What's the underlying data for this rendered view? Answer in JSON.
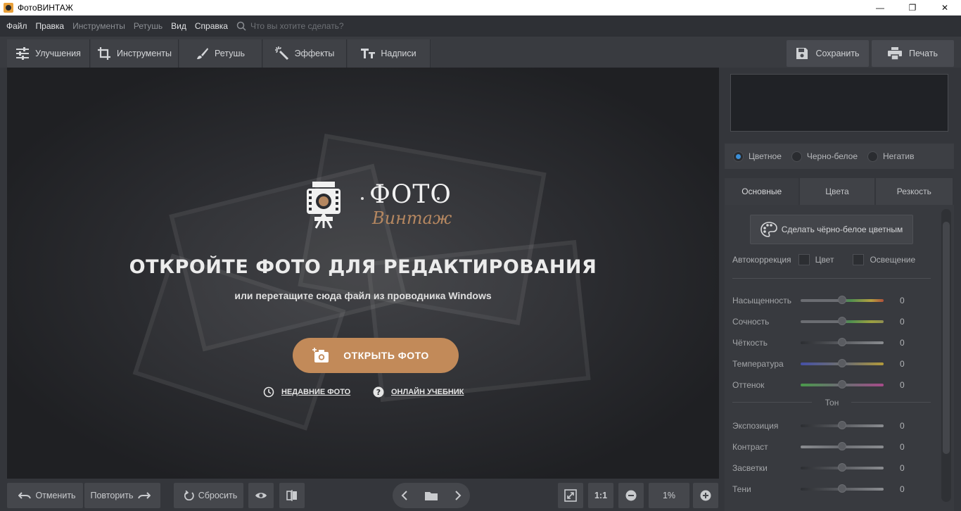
{
  "window": {
    "title": "ФотоВИНТАЖ",
    "minimize": "—",
    "maximize": "❐",
    "close": "✕"
  },
  "menu": {
    "items": [
      "Файл",
      "Правка",
      "Инструменты",
      "Ретушь",
      "Вид",
      "Справка"
    ],
    "search_placeholder": "Что вы хотите сделать?"
  },
  "toolbar": {
    "tabs": [
      "Улучшения",
      "Инструменты",
      "Ретушь",
      "Эффекты",
      "Надписи"
    ],
    "save_label": "Сохранить",
    "print_label": "Печать"
  },
  "canvas": {
    "logo_word": "ФОТО",
    "logo_sub": "Винтаж",
    "heading": "ОТКРОЙТЕ ФОТО ДЛЯ РЕДАКТИРОВАНИЯ",
    "subheading": "или перетащите сюда файл из проводника Windows",
    "open_button": "ОТКРЫТЬ ФОТО",
    "recent_link": "НЕДАВНИЕ ФОТО",
    "tutorial_link": "ОНЛАЙН УЧЕБНИК"
  },
  "panel": {
    "modes": [
      "Цветное",
      "Черно-белое",
      "Негатив"
    ],
    "selected_mode": "Цветное",
    "subtabs": [
      "Основные",
      "Цвета",
      "Резкость"
    ],
    "bw_button": "Сделать чёрно-белое цветным",
    "auto_label": "Автокоррекция",
    "auto_color": "Цвет",
    "auto_light": "Освещение",
    "sliders": [
      {
        "label": "Насыщенность",
        "value": "0"
      },
      {
        "label": "Сочность",
        "value": "0"
      },
      {
        "label": "Чёткость",
        "value": "0"
      },
      {
        "label": "Температура",
        "value": "0"
      },
      {
        "label": "Оттенок",
        "value": "0"
      }
    ],
    "tone_label": "Тон",
    "tone_sliders": [
      {
        "label": "Экспозиция",
        "value": "0"
      },
      {
        "label": "Контраст",
        "value": "0"
      },
      {
        "label": "Засветки",
        "value": "0"
      },
      {
        "label": "Тени",
        "value": "0"
      }
    ]
  },
  "bottom": {
    "undo": "Отменить",
    "redo": "Повторить",
    "reset": "Сбросить",
    "zoom_1to1": "1:1",
    "zoom_value": "1%"
  },
  "colors": {
    "accent": "#c28a59",
    "radio_on": "#3b8fd8"
  }
}
